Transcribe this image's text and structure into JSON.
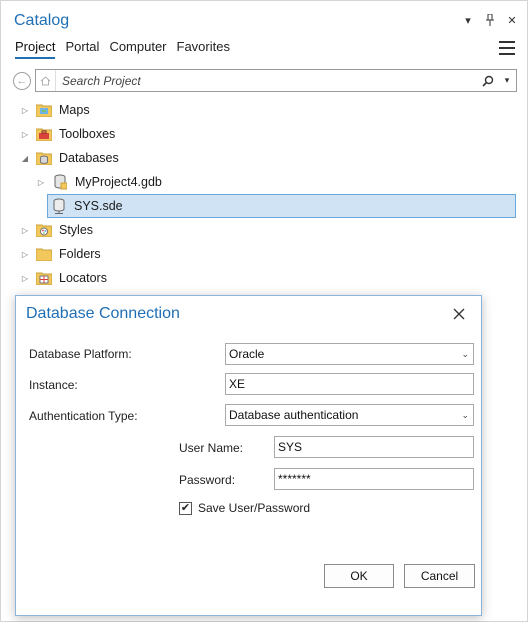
{
  "catalog": {
    "title": "Catalog",
    "tabs": [
      {
        "label": "Project",
        "active": true
      },
      {
        "label": "Portal",
        "active": false
      },
      {
        "label": "Computer",
        "active": false
      },
      {
        "label": "Favorites",
        "active": false
      }
    ],
    "search_placeholder": "Search Project",
    "tree": [
      {
        "label": "Maps",
        "icon": "maps-folder-icon",
        "expanded": false,
        "level": 0
      },
      {
        "label": "Toolboxes",
        "icon": "toolboxes-folder-icon",
        "expanded": false,
        "level": 0
      },
      {
        "label": "Databases",
        "icon": "databases-folder-icon",
        "expanded": true,
        "level": 0
      },
      {
        "label": "MyProject4.gdb",
        "icon": "geodatabase-icon",
        "expanded": false,
        "level": 1
      },
      {
        "label": "SYS.sde",
        "icon": "sde-connection-icon",
        "expanded": null,
        "level": 1,
        "selected": true
      },
      {
        "label": "Styles",
        "icon": "styles-folder-icon",
        "expanded": false,
        "level": 0
      },
      {
        "label": "Folders",
        "icon": "folders-folder-icon",
        "expanded": false,
        "level": 0
      },
      {
        "label": "Locators",
        "icon": "locators-folder-icon",
        "expanded": false,
        "level": 0
      }
    ]
  },
  "dialog": {
    "title": "Database Connection",
    "platform_label": "Database Platform:",
    "platform_value": "Oracle",
    "instance_label": "Instance:",
    "instance_value": "XE",
    "auth_label": "Authentication Type:",
    "auth_value": "Database authentication",
    "username_label": "User Name:",
    "username_value": "SYS",
    "password_label": "Password:",
    "password_value": "*******",
    "save_label": "Save User/Password",
    "save_checked": true,
    "ok_label": "OK",
    "cancel_label": "Cancel"
  },
  "colors": {
    "accent": "#1f6fb5",
    "selection": "#cfe3f5",
    "selection_border": "#6aa7dc"
  }
}
